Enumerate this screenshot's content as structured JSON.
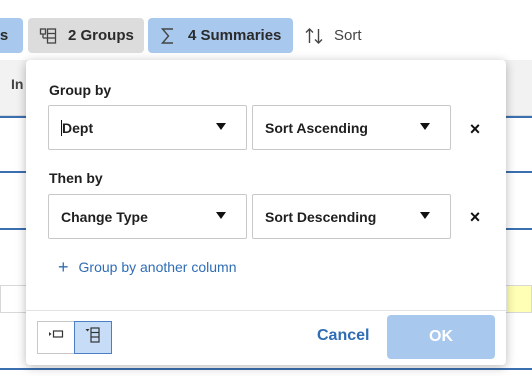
{
  "toolbar": {
    "filters_label": "rs",
    "groups_label": "2 Groups",
    "summaries_label": "4 Summaries",
    "sort_label": "Sort"
  },
  "grid": {
    "header_label": "In"
  },
  "group_popup": {
    "group_by_label": "Group by",
    "then_by_label": "Then by",
    "rows": [
      {
        "column": "Dept",
        "order": "Sort Ascending"
      },
      {
        "column": "Change Type",
        "order": "Sort Descending"
      }
    ],
    "remove_glyph": "×",
    "add_label": "Group by another column",
    "add_glyph": "+",
    "cancel_label": "Cancel",
    "ok_label": "OK"
  },
  "colors": {
    "accent_blue": "#2f6db4",
    "button_blue": "#a8c8ee",
    "row_highlight": "#ffffb5"
  },
  "icons": [
    "group-icon",
    "sigma-icon",
    "sort-icon",
    "caret-down-icon",
    "close-icon",
    "plus-icon",
    "collapsed-view-icon",
    "expanded-view-icon"
  ]
}
